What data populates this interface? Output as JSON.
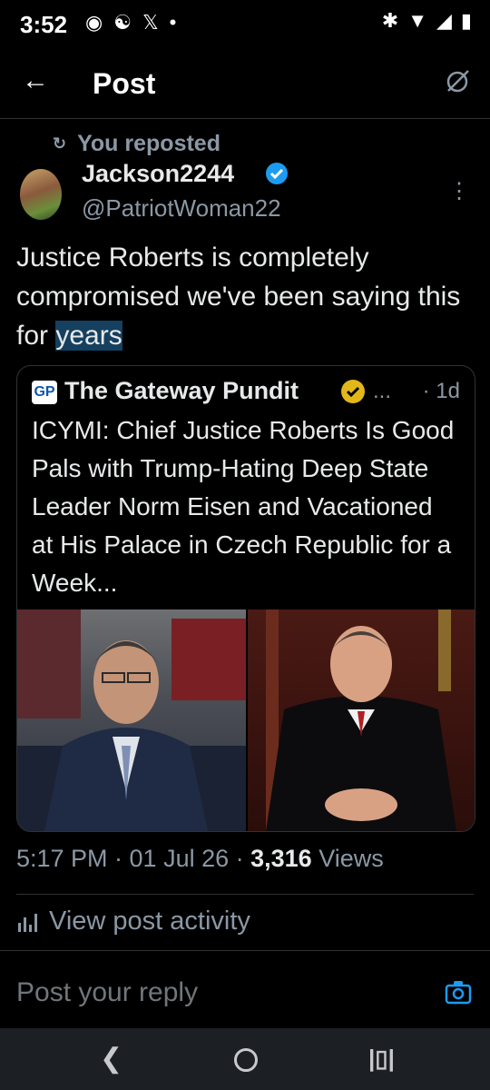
{
  "status_bar": {
    "time": "3:52"
  },
  "header": {
    "title": "Post"
  },
  "repost": {
    "label": "You reposted"
  },
  "author": {
    "name": "Jackson2244",
    "handle": "@PatriotWoman22"
  },
  "tweet": {
    "text_before": "Justice Roberts is completely compromised we've been saying this for ",
    "text_highlight": "years"
  },
  "quote": {
    "logo_text": "GP",
    "name": "The Gateway Pundit",
    "ellipsis": "...",
    "time": "· 1d",
    "text": "ICYMI: Chief Justice Roberts Is Good Pals with Trump-Hating Deep State Leader Norm Eisen and Vacationed at His Palace in Czech Republic for a Week..."
  },
  "meta": {
    "time": "5:17 PM · 01 Jul 26 · ",
    "views_count": "3,316",
    "views_label": " Views"
  },
  "activity": {
    "label": "View post activity"
  },
  "reply": {
    "placeholder": "Post your reply"
  },
  "colors": {
    "accent": "#1d9bf0",
    "muted": "#8b98a5",
    "gold": "#e2b719"
  }
}
